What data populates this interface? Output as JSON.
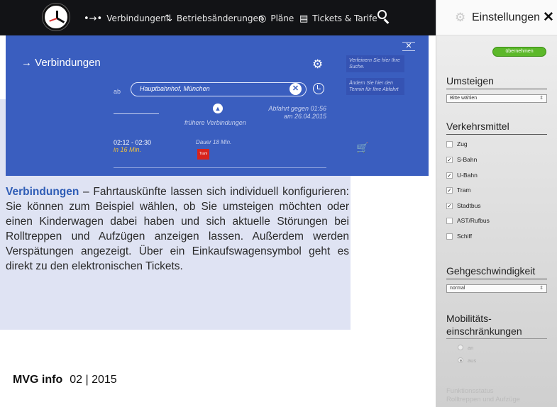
{
  "nav": {
    "logo_icon": "station-clock-icon",
    "items": [
      {
        "icon": "route-arrows-icon",
        "glyph": "•→•",
        "label": "Verbindungen"
      },
      {
        "icon": "disruption-icon",
        "glyph": "⇅",
        "label": "Betriebsänderungen"
      },
      {
        "icon": "map-icon",
        "glyph": "◎",
        "label": "Pläne"
      },
      {
        "icon": "ticket-icon",
        "glyph": "▤",
        "label": "Tickets & Tarife"
      }
    ],
    "search_icon": "search-icon"
  },
  "connections": {
    "title": "→  Verbindungen",
    "from_label": "ab",
    "from_value": "Hauptbahnhof, München",
    "clear_glyph": "✕",
    "earlier_label": "frühere Verbindungen",
    "departure_line1": "Abfahrt gegen 01:56",
    "departure_line2": "am 26.04.2015",
    "trip_time": "02:12 - 02:30",
    "trip_relative": "in 16 Min.",
    "trip_duration": "Dauer 18 Min.",
    "tram_badge": "Tram",
    "hint_1": "Verfeinern Sie hier Ihre Suche.",
    "hint_2": "Ändern Sie hier den Termin für Ihre Abfahrt",
    "close_glyph": "✕"
  },
  "caption": {
    "lead": "Verbindungen",
    "dash": " – ",
    "body": "Fahrtauskünfte lassen sich individuell konfigurieren: Sie können zum Beispiel wählen, ob Sie umsteigen möchten oder einen Kinderwagen dabei haben und sich aktuelle Störungen bei Rolltreppen und Aufzügen anzeigen lassen. Außerdem werden Verspätungen angezeigt. Über ein Einkaufswagensymbol geht es direkt zu den elektronischen Tickets."
  },
  "footer": {
    "brand": "MVG info",
    "issue": "02 | 2015"
  },
  "settings": {
    "title": "Einstellungen",
    "close_glyph": "✕",
    "apply_label": "übernehmen",
    "transfer": {
      "title": "Umsteigen",
      "select_value": "Bitte wählen"
    },
    "modes": {
      "title": "Verkehrsmittel",
      "items": [
        {
          "label": "Zug",
          "checked": false,
          "mark": ""
        },
        {
          "label": "S-Bahn",
          "checked": true,
          "mark": "✓"
        },
        {
          "label": "U-Bahn",
          "checked": true,
          "mark": "✓"
        },
        {
          "label": "Tram",
          "checked": true,
          "mark": "✓"
        },
        {
          "label": "Stadtbus",
          "checked": true,
          "mark": "✓"
        },
        {
          "label": "AST/Rufbus",
          "checked": false,
          "mark": ""
        },
        {
          "label": "Schiff",
          "checked": false,
          "mark": ""
        }
      ]
    },
    "speed": {
      "title": "Gehgeschwindigkeit",
      "select_value": "normal"
    },
    "mobility": {
      "title_line1": "Mobilitäts-",
      "title_line2": "einschränkungen",
      "options": [
        {
          "label": "an",
          "selected": false
        },
        {
          "label": "aus",
          "selected": true
        }
      ]
    },
    "status": {
      "title_line1": "Funktionsstatus",
      "title_line2": "Rolltreppen und Aufzüge"
    }
  }
}
